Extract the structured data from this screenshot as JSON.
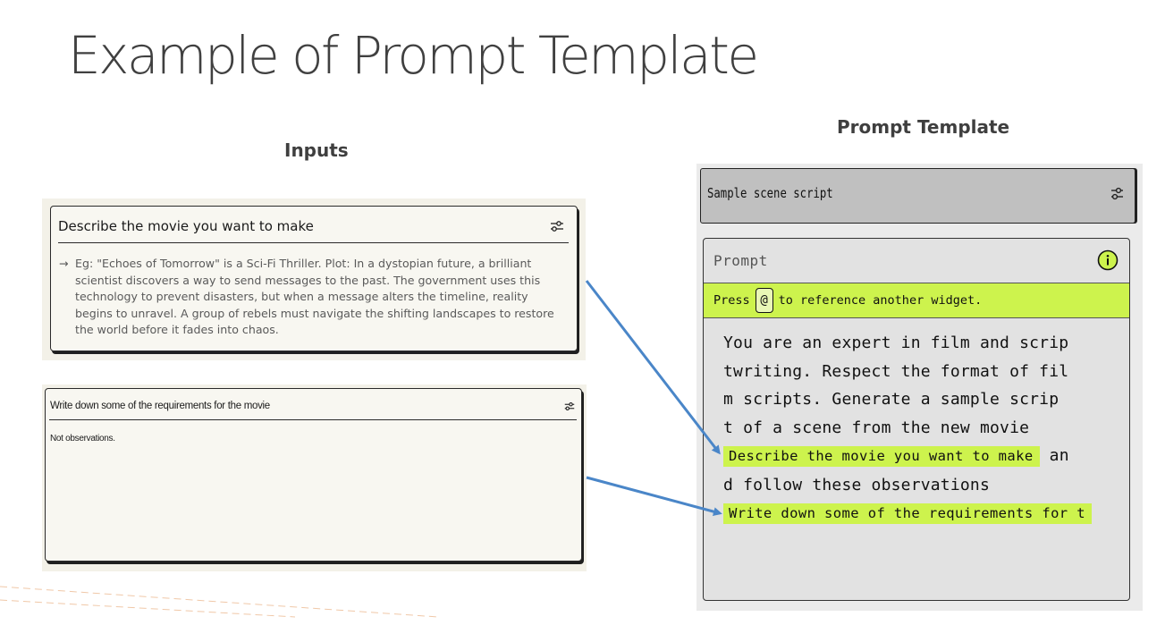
{
  "slide": {
    "title": "Example of Prompt Template",
    "inputs_heading": "Inputs",
    "template_heading": "Prompt Template"
  },
  "input_card_1": {
    "title": "Describe the movie you want to make",
    "arrow_glyph": "→",
    "body": "Eg: \"Echoes of Tomorrow\" is a Sci-Fi Thriller. Plot: In a dystopian future, a brilliant scientist discovers a way to send messages to the past. The government uses this technology to prevent disasters, but when a message alters the timeline, reality begins to unravel. A group of rebels must navigate the shifting landscapes to restore the world before it fades into chaos."
  },
  "input_card_2": {
    "title": "Write down some of the requirements for the movie",
    "body": "Not observations."
  },
  "template": {
    "widget_title": "Sample scene script",
    "prompt_label": "Prompt",
    "hint_prefix": "Press",
    "hint_key": "@",
    "hint_suffix": "to reference another widget.",
    "lines": [
      "You are an expert in film and scrip",
      "twriting. Respect the format of fil",
      "m scripts. Generate a sample scrip",
      "t of a scene from the new movie"
    ],
    "chip_1": "Describe the movie you want to make",
    "after_chip_1": " an",
    "line_6": "d follow these observations",
    "chip_2": "Write down some of the requirements for t"
  },
  "icons": {
    "settings": "sliders-icon",
    "info": "info-icon",
    "arrow": "arrow-icon"
  },
  "colors": {
    "highlight": "#cdf34d",
    "connector_arrow": "#4a86c8",
    "card_background": "#f8f7f1",
    "panel_background": "#e2e2e2"
  }
}
